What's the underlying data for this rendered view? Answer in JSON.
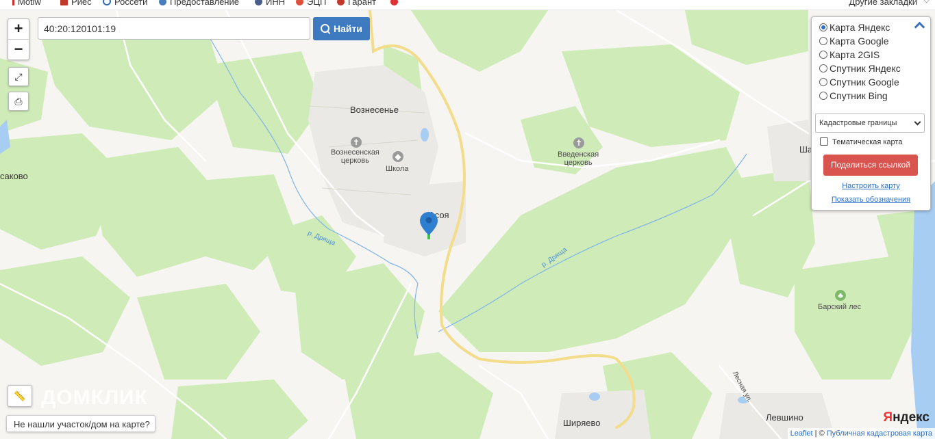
{
  "bookmarks": {
    "items": [
      {
        "label": "Motiw",
        "color": "#d03030"
      },
      {
        "label": "Риес",
        "color": "#c0392b"
      },
      {
        "label": "Россети",
        "color": "#2d6fbf"
      },
      {
        "label": "Предоставление",
        "color": "#4a7dbb"
      },
      {
        "label": "ИНН",
        "color": "#4a5e8c"
      },
      {
        "label": "ЭЦП",
        "color": "#e0503a"
      },
      {
        "label": "Гарант",
        "color": "#c0392b"
      },
      {
        "label": "",
        "color": "#e03030"
      }
    ],
    "other_label": "Другие закладки"
  },
  "search": {
    "value": "40:20:120101:19",
    "button_label": "Найти"
  },
  "zoom": {
    "in_label": "+",
    "out_label": "−"
  },
  "layers": {
    "options": [
      {
        "label": "Карта Яндекс",
        "selected": true
      },
      {
        "label": "Карта Google",
        "selected": false
      },
      {
        "label": "Карта 2GIS",
        "selected": false
      },
      {
        "label": "Спутник Яндекс",
        "selected": false
      },
      {
        "label": "Спутник Google",
        "selected": false
      },
      {
        "label": "Спутник Bing",
        "selected": false
      }
    ],
    "overlay_select": "Кадастровые границы",
    "thematic_label": "Тематическая карта",
    "thematic_checked": false,
    "share_label": "Поделиться ссылкой",
    "configure_label": "Настроить карту",
    "legend_label": "Показать обозначения"
  },
  "map_labels": {
    "voznesenye": "Вознесенье",
    "church1_line1": "Вознесенская",
    "church1_line2": "церковь",
    "school": "Школа",
    "asoya": "Асоя",
    "church2_line1": "Введенская",
    "church2_line2": "церковь",
    "sakovo": "саково",
    "river1": "р. Дряща",
    "river2": "р. Дряща",
    "barsky": "Барский лес",
    "shiryaevo": "Ширяево",
    "levshino": "Левшино",
    "sha": "Ша",
    "lesnaya": "Лесная ул."
  },
  "watermark": "ДОМКЛИК",
  "not_found_label": "Не нашли участок/дом на карте?",
  "yandex_logo": {
    "first": "Я",
    "rest": "ндекс"
  },
  "attribution": {
    "leaflet": "Leaflet",
    "separator": " | © ",
    "pkk": "Публичная кадастровая карта"
  },
  "colors": {
    "forest": "#cfecb8",
    "background": "#f6f5f1",
    "road": "#f7e7a5",
    "water": "#a7cdf2",
    "accent": "#3d7ac0",
    "share": "#d9534f",
    "marker": "#2f7fd0"
  }
}
